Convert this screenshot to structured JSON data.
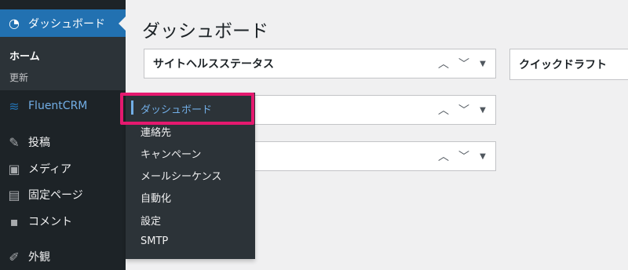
{
  "sidebar": {
    "dashboard": {
      "label": "ダッシュボード",
      "icon": "dashboard-icon"
    },
    "submenu": {
      "home": "ホーム",
      "updates": "更新"
    },
    "fluentcrm": {
      "label": "FluentCRM",
      "icon": "fluentcrm-icon"
    },
    "posts": {
      "label": "投稿",
      "icon": "pin-icon"
    },
    "media": {
      "label": "メディア",
      "icon": "media-icon"
    },
    "pages": {
      "label": "固定ページ",
      "icon": "page-icon"
    },
    "comments": {
      "label": "コメント",
      "icon": "comment-icon"
    },
    "appearance": {
      "label": "外観",
      "icon": "brush-icon"
    }
  },
  "flyout": {
    "items": [
      "ダッシュボード",
      "連絡先",
      "キャンペーン",
      "メールシーケンス",
      "自動化",
      "設定",
      "SMTP"
    ]
  },
  "main": {
    "title": "ダッシュボード",
    "panels": [
      {
        "title": "サイトヘルスステータス"
      },
      {
        "title": ""
      },
      {
        "title": ""
      }
    ],
    "right_panel": {
      "title": "クイックドラフト"
    }
  },
  "colors": {
    "sidebar_bg": "#1d2327",
    "accent": "#2271b1",
    "highlight": "#e5196f"
  }
}
